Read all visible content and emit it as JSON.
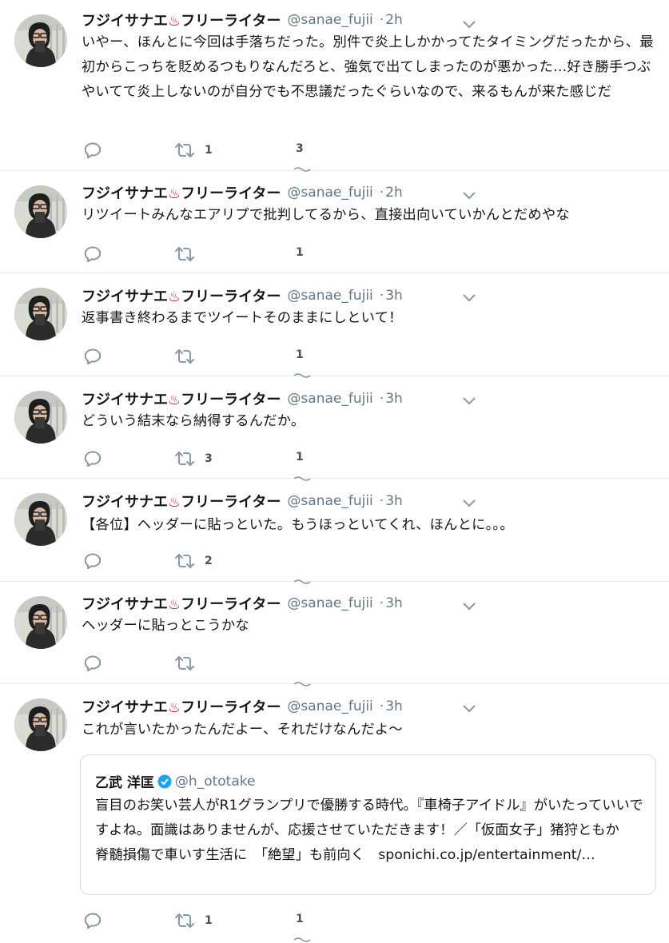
{
  "author": {
    "name_pre": "フジイサナエ",
    "name_icon": "♨",
    "name_post": "フリーライター",
    "handle": "@sanae_fujii",
    "dot": "·"
  },
  "icons": [
    "reply-icon",
    "retweet-icon",
    "caret-down-icon",
    "verified-icon",
    "more-dots-icon",
    "avatar"
  ],
  "colors": {
    "text": "#14171a",
    "secondary": "#657786",
    "icon": "#8899a6",
    "border": "#e6ecf0",
    "verified": "#1da1f2",
    "hot_spring": "#c0263a"
  },
  "tweets": [
    {
      "time": "2h",
      "text": "いやー、ほんとに今回は手落ちだった。別件で炎上しかかってたタイミングだったから、最初からこっちを貶めるつもりなんだろと、強気で出てしまったのが悪かった…好き勝手つぶやいてて炎上しないのが自分でも不思議だったぐらいなので、来るもんが来た感じだ",
      "retweets": "1",
      "likes": "3"
    },
    {
      "time": "2h",
      "text": "リツイートみんなエアリプで批判してるから、直接出向いていかんとだめやな",
      "retweets": "",
      "likes": "1"
    },
    {
      "time": "3h",
      "text": "返事書き終わるまでツイートそのままにしといて！",
      "retweets": "",
      "likes": "1"
    },
    {
      "time": "3h",
      "text": "どういう結末なら納得するんだか。",
      "retweets": "3",
      "likes": "1"
    },
    {
      "time": "3h",
      "text": "【各位】ヘッダーに貼っといた。もうほっといてくれ、ほんとに。。。",
      "retweets": "2",
      "likes": ""
    },
    {
      "time": "3h",
      "text": "ヘッダーに貼っとこうかな",
      "retweets": "",
      "likes": ""
    },
    {
      "time": "3h",
      "text": "これが言いたかったんだよー、それだけなんだよ〜",
      "retweets": "1",
      "likes": "1",
      "quote": {
        "name": "乙武 洋匡",
        "handle": "@h_ototake",
        "text": "盲目のお笑い芸人がR1グランプリで優勝する時代。『車椅子アイドル』がいたっていいですよね。面識はありませんが、応援させていただきます！／「仮面女子」猪狩ともか　脊髄損傷で車いす生活に　「絶望」も前向く　sponichi.co.jp/entertainment/…"
      }
    }
  ]
}
